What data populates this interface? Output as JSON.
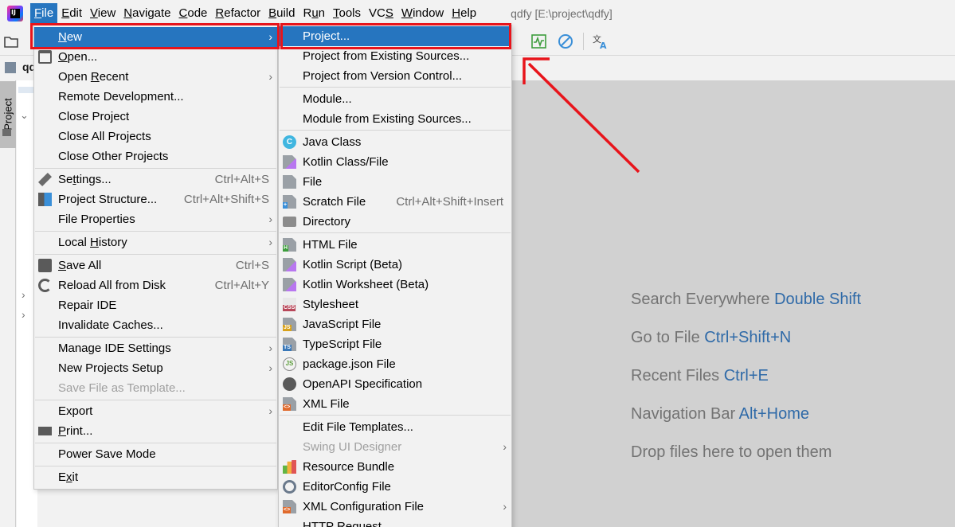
{
  "menubar": {
    "items": [
      "File",
      "Edit",
      "View",
      "Navigate",
      "Code",
      "Refactor",
      "Build",
      "Run",
      "Tools",
      "VCS",
      "Window",
      "Help"
    ],
    "mnemonics": [
      "F",
      "E",
      "V",
      "N",
      "C",
      "R",
      "B",
      "u",
      "T",
      "S",
      "W",
      "H"
    ],
    "window_title": "qdfy [E:\\project\\qdfy]"
  },
  "side": {
    "project_tab": "Project",
    "breadcrumb": "qd"
  },
  "file_menu": {
    "items": [
      {
        "label": "New",
        "mn": "N",
        "arrow": true,
        "selected": true
      },
      {
        "label": "Open...",
        "mn": "O",
        "icon": "folder-open-icon"
      },
      {
        "label": "Open Recent",
        "mn": "R",
        "arrow": true
      },
      {
        "label": "Remote Development..."
      },
      {
        "label": "Close Project"
      },
      {
        "label": "Close All Projects"
      },
      {
        "label": "Close Other Projects"
      },
      {
        "label": "Settings...",
        "mn": "t",
        "shortcut": "Ctrl+Alt+S",
        "icon": "wrench-icon"
      },
      {
        "label": "Project Structure...",
        "shortcut": "Ctrl+Alt+Shift+S",
        "icon": "project-structure-icon"
      },
      {
        "label": "File Properties",
        "arrow": true
      },
      {
        "label": "Local History",
        "mn": "H",
        "arrow": true
      },
      {
        "label": "Save All",
        "mn": "S",
        "shortcut": "Ctrl+S",
        "icon": "save-icon"
      },
      {
        "label": "Reload All from Disk",
        "shortcut": "Ctrl+Alt+Y",
        "icon": "reload-icon"
      },
      {
        "label": "Repair IDE"
      },
      {
        "label": "Invalidate Caches..."
      },
      {
        "label": "Manage IDE Settings",
        "arrow": true
      },
      {
        "label": "New Projects Setup",
        "arrow": true
      },
      {
        "label": "Save File as Template...",
        "disabled": true
      },
      {
        "label": "Export",
        "arrow": true
      },
      {
        "label": "Print...",
        "mn": "P",
        "icon": "printer-icon"
      },
      {
        "label": "Power Save Mode"
      },
      {
        "label": "Exit",
        "mn": "x"
      }
    ]
  },
  "new_menu": {
    "items": [
      {
        "label": "Project...",
        "selected": true
      },
      {
        "label": "Project from Existing Sources..."
      },
      {
        "label": "Project from Version Control..."
      },
      {
        "label": "Module..."
      },
      {
        "label": "Module from Existing Sources..."
      },
      {
        "label": "Java Class",
        "icon": "java-class-icon"
      },
      {
        "label": "Kotlin Class/File",
        "icon": "kotlin-file-icon"
      },
      {
        "label": "File",
        "icon": "file-icon"
      },
      {
        "label": "Scratch File",
        "shortcut": "Ctrl+Alt+Shift+Insert",
        "icon": "scratch-file-icon"
      },
      {
        "label": "Directory",
        "icon": "folder-icon"
      },
      {
        "label": "HTML File",
        "icon": "html-file-icon"
      },
      {
        "label": "Kotlin Script (Beta)",
        "icon": "kotlin-script-icon"
      },
      {
        "label": "Kotlin Worksheet (Beta)",
        "icon": "kotlin-worksheet-icon"
      },
      {
        "label": "Stylesheet",
        "icon": "css-file-icon"
      },
      {
        "label": "JavaScript File",
        "icon": "js-file-icon"
      },
      {
        "label": "TypeScript File",
        "icon": "ts-file-icon"
      },
      {
        "label": "package.json File",
        "icon": "nodejs-icon"
      },
      {
        "label": "OpenAPI Specification",
        "icon": "openapi-icon"
      },
      {
        "label": "XML File",
        "icon": "xml-file-icon"
      },
      {
        "label": "Edit File Templates..."
      },
      {
        "label": "Swing UI Designer",
        "disabled": true,
        "arrow": true
      },
      {
        "label": "Resource Bundle",
        "icon": "resource-bundle-icon"
      },
      {
        "label": "EditorConfig File",
        "icon": "editorconfig-icon"
      },
      {
        "label": "XML Configuration File",
        "arrow": true,
        "icon": "xml-config-icon"
      },
      {
        "label": "HTTP Request"
      }
    ]
  },
  "editor_hints": [
    {
      "text": "Search Everywhere",
      "key": "Double Shift"
    },
    {
      "text": "Go to File",
      "key": "Ctrl+Shift+N"
    },
    {
      "text": "Recent Files",
      "key": "Ctrl+E"
    },
    {
      "text": "Navigation Bar",
      "key": "Alt+Home"
    },
    {
      "text": "Drop files here to open them",
      "key": ""
    }
  ],
  "colors": {
    "selection": "#2675bf",
    "highlight_box": "#e8141b",
    "hint_key": "#2f6aa8"
  }
}
